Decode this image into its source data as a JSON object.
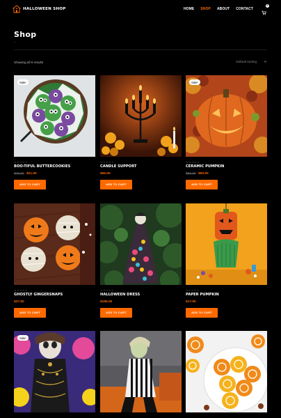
{
  "header": {
    "logo_text": "HALLOWEEN SHOP",
    "nav": [
      "HOME",
      "SHOP",
      "ABOUT",
      "CONTACT"
    ],
    "active_nav": "SHOP",
    "cart_count": "0"
  },
  "page": {
    "title": "Shop",
    "results_text": "Showing all 9 results",
    "sort_label": "Default sorting"
  },
  "products": [
    {
      "title": "BOO-TIFUL BUTTERCOOKIES",
      "old_price": "$25.00",
      "price": "$21.00",
      "sale": "Sale!",
      "button": "ADD TO CART"
    },
    {
      "title": "CANDLE SUPPORT",
      "old_price": "",
      "price": "$65.00",
      "sale": "",
      "button": "ADD TO CART"
    },
    {
      "title": "CERAMIC PUMPKIN",
      "old_price": "$55.00",
      "price": "$50.00",
      "sale": "Sale!",
      "button": "ADD TO CART"
    },
    {
      "title": "GHOSTLY GINGERSNAPS",
      "old_price": "",
      "price": "$27.00",
      "sale": "",
      "button": "ADD TO CART"
    },
    {
      "title": "HALLOWEEN DRESS",
      "old_price": "",
      "price": "$195.00",
      "sale": "",
      "button": "ADD TO CART"
    },
    {
      "title": "PAPER PUMPKIN",
      "old_price": "",
      "price": "$17.00",
      "sale": "",
      "button": "ADD TO CART"
    },
    {
      "title": "",
      "old_price": "",
      "price": "",
      "sale": "Sale!",
      "button": ""
    },
    {
      "title": "",
      "old_price": "",
      "price": "",
      "sale": "",
      "button": ""
    },
    {
      "title": "",
      "old_price": "",
      "price": "",
      "sale": "",
      "button": ""
    }
  ],
  "colors": {
    "accent": "#ff6a00",
    "background": "#000000"
  }
}
